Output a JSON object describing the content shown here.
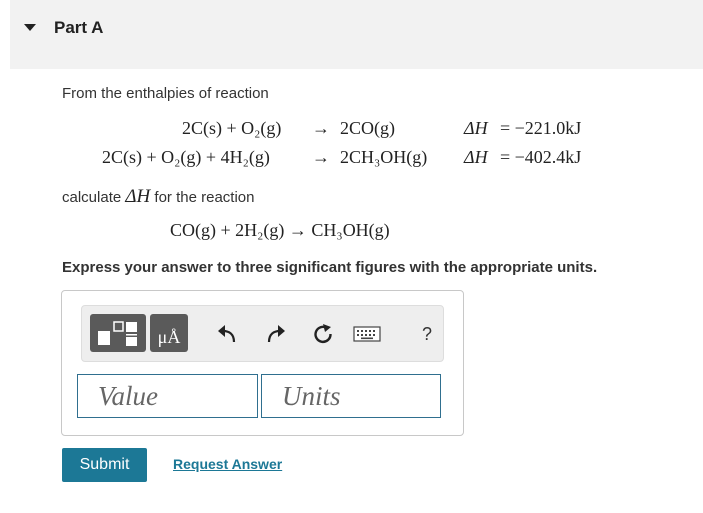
{
  "part": {
    "title": "Part A"
  },
  "problem": {
    "intro": "From the enthalpies of reaction",
    "reactions": [
      {
        "left": "2C(s) + O₂(g)",
        "arrow": "→",
        "right": "2CO(g)",
        "dh_label": "ΔH",
        "dh_value": "= −221.0kJ"
      },
      {
        "left": "2C(s) + O₂(g) + 4H₂(g)",
        "arrow": "→",
        "right": "2CH₃OH(g)",
        "dh_label": "ΔH",
        "dh_value": "= −402.4kJ"
      }
    ],
    "calc_prefix": "calculate",
    "calc_dh": "ΔH",
    "calc_suffix": "for the reaction",
    "target_reaction": "CO(g) + 2H₂(g) → CH₃OH(g)",
    "instruction": "Express your answer to three significant figures with the appropriate units."
  },
  "answer": {
    "toolbar": {
      "units_button": "μÅ",
      "help": "?"
    },
    "value_placeholder": "Value",
    "units_placeholder": "Units"
  },
  "actions": {
    "submit": "Submit",
    "request_answer": "Request Answer"
  },
  "colors": {
    "accent": "#1c7896",
    "header_bg": "#f2f2f2",
    "toolbar_button": "#5a5a5a"
  }
}
